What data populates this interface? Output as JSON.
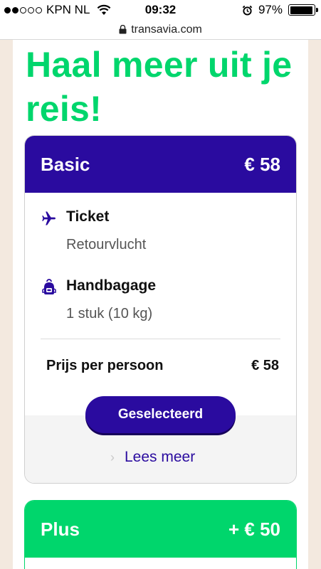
{
  "status_bar": {
    "carrier": "KPN NL",
    "time": "09:32",
    "battery": "97%",
    "battery_level": 0.97,
    "signal_bars": 2,
    "icons": [
      "signal-dots-icon",
      "wifi-icon",
      "alarm-icon",
      "battery-icon"
    ]
  },
  "browser": {
    "url": "transavia.com",
    "icon": "lock-icon"
  },
  "page": {
    "headline": "Haal meer uit je reis!"
  },
  "basic_card": {
    "name": "Basic",
    "price": "€ 58",
    "features": [
      {
        "title": "Ticket",
        "subtitle": "Retourvlucht",
        "icon": "plane-icon"
      },
      {
        "title": "Handbagage",
        "subtitle": "1 stuk (10 kg)",
        "icon": "backpack-icon"
      }
    ],
    "price_label": "Prijs per persoon",
    "price_value": "€ 58",
    "select_button": "Geselecteerd",
    "read_more": "Lees meer"
  },
  "plus_card": {
    "name": "Plus",
    "price": "+ € 50"
  },
  "colors": {
    "brand_green": "#00d66c",
    "brand_purple": "#2a0b9f",
    "background": "#f3e9df"
  }
}
